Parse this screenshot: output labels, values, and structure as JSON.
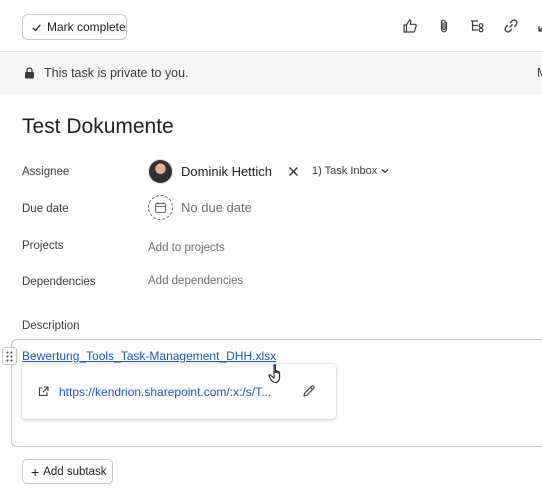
{
  "toolbar": {
    "mark_complete_label": "Mark complete",
    "icons": [
      "thumbs-up-icon",
      "paperclip-icon",
      "subtask-icon",
      "link-icon",
      "expand-icon"
    ]
  },
  "privacy": {
    "text": "This task is private to you.",
    "trailing": "M"
  },
  "task": {
    "title": "Test Dokumente"
  },
  "fields": {
    "assignee_label": "Assignee",
    "assignee_name": "Dominik Hettich",
    "assignee_section": "1) Task Inbox",
    "due_label": "Due date",
    "due_value": "No due date",
    "projects_label": "Projects",
    "projects_action": "Add to projects",
    "dependencies_label": "Dependencies",
    "dependencies_action": "Add dependencies",
    "description_label": "Description"
  },
  "description": {
    "file_link": "Bewertung_Tools_Task-Management_DHH.xlsx",
    "card_url": "https://kendrion.sharepoint.com/:x:/s/T..."
  },
  "subtask": {
    "add_label": "Add subtask"
  },
  "colors": {
    "link": "#1a55c7",
    "privacy_bg": "#f6f6f7",
    "border": "#c7c8ca"
  }
}
